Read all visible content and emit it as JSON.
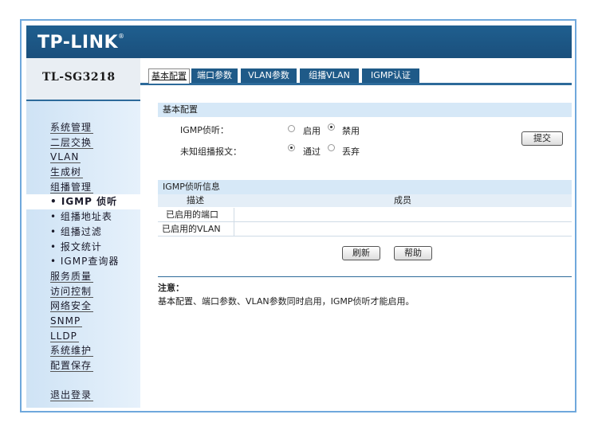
{
  "header": {
    "logo": "TP-LINK",
    "logo_mark": "®"
  },
  "sidebar": {
    "model": "TL-SG3218",
    "items": [
      {
        "label": "系统管理",
        "type": "main"
      },
      {
        "label": "二层交换",
        "type": "main"
      },
      {
        "label": "VLAN",
        "type": "main"
      },
      {
        "label": "生成树",
        "type": "main"
      },
      {
        "label": "组播管理",
        "type": "main"
      },
      {
        "label": "• IGMP 侦听",
        "type": "sub",
        "active": true
      },
      {
        "label": "• 组播地址表",
        "type": "sub"
      },
      {
        "label": "• 组播过滤",
        "type": "sub"
      },
      {
        "label": "• 报文统计",
        "type": "sub"
      },
      {
        "label": "• IGMP查询器",
        "type": "sub"
      },
      {
        "label": "服务质量",
        "type": "main"
      },
      {
        "label": "访问控制",
        "type": "main"
      },
      {
        "label": "网络安全",
        "type": "main"
      },
      {
        "label": "SNMP",
        "type": "main"
      },
      {
        "label": "LLDP",
        "type": "main"
      },
      {
        "label": "系统维护",
        "type": "main"
      },
      {
        "label": "配置保存",
        "type": "main"
      }
    ],
    "logout": "退出登录"
  },
  "tabs": [
    {
      "label": "基本配置",
      "active": true
    },
    {
      "label": "端口参数",
      "active": false
    },
    {
      "label": "VLAN参数",
      "active": false
    },
    {
      "label": "组播VLAN",
      "active": false
    },
    {
      "label": "IGMP认证",
      "active": false
    }
  ],
  "basic": {
    "section_title": "基本配置",
    "snooping_label": "IGMP侦听：",
    "snooping_opt1": "启用",
    "snooping_opt2": "禁用",
    "snooping_value": "禁用",
    "unknown_label": "未知组播报文：",
    "unknown_opt1": "通过",
    "unknown_opt2": "丢弃",
    "unknown_value": "通过",
    "submit": "提交"
  },
  "info": {
    "section_title": "IGMP侦听信息",
    "col_desc": "描述",
    "col_member": "成员",
    "rows": [
      {
        "desc": "已启用的端口",
        "member": ""
      },
      {
        "desc": "已启用的VLAN",
        "member": ""
      }
    ],
    "refresh": "刷新",
    "help": "帮助"
  },
  "note": {
    "title": "注意：",
    "text": "基本配置、端口参数、VLAN参数同时启用，IGMP侦听才能启用。"
  },
  "colors": {
    "header": "#1a4f7c",
    "sidebar": "#d6e8f7",
    "accent": "#2d6a9a",
    "frame": "#6fa8dc"
  }
}
